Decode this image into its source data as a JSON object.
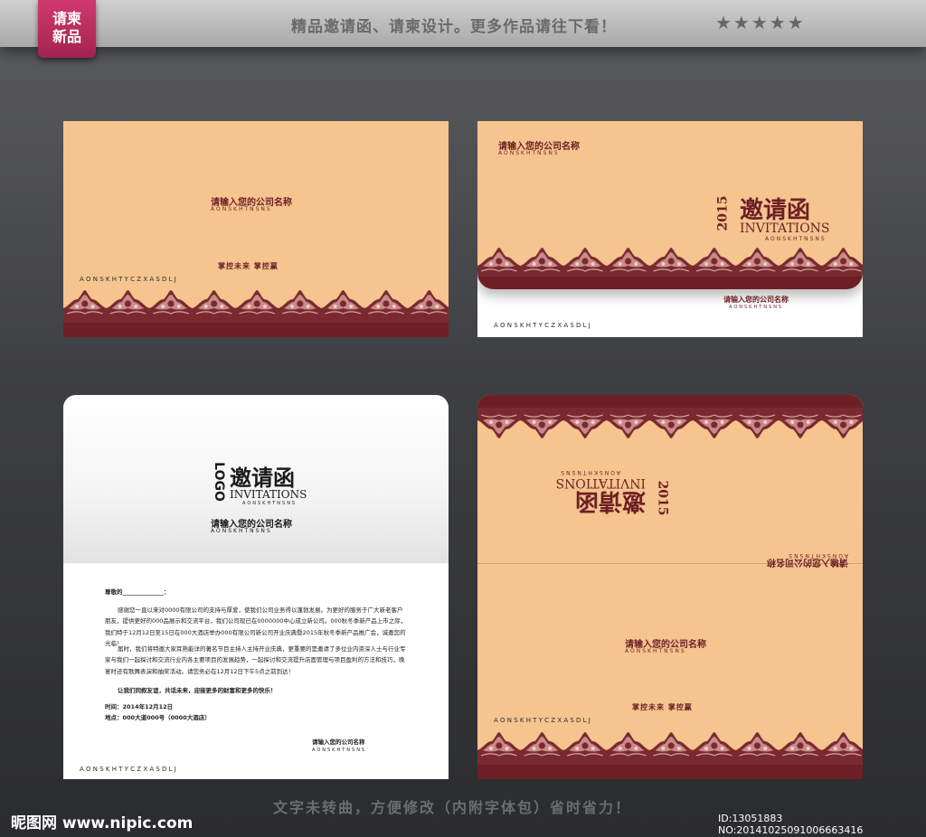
{
  "header": {
    "badge_line1": "请柬",
    "badge_line2": "新品",
    "title": "精品邀请函、请柬设计。更多作品请往下看！",
    "stars": "★★★★★"
  },
  "card": {
    "company_name": "请输入您的公司名称",
    "company_sub": "AONSKHTNSNS",
    "slogan": "掌控未来  掌控赢",
    "letters": "A  O  N  S  K  H  T  Y  C  Z  X  A  S  D  L  J",
    "invite_cn": "邀请函",
    "invite_en": "INVITATIONS",
    "invite_sub": "AONSKHTNSNS",
    "year": "2015",
    "logo": "LOGO"
  },
  "letter": {
    "greeting": "尊敬的______________：",
    "body": "感谢您一直以来对0000有限公司的支持与厚爱，使我们公司业务得以蓬勃发展。为更好的服务于广大新老客户朋友，提供更好的000品展示和交流平台，我们公司现已在0000000中心成立新公司。000秋冬季新产品上市之际，我们特于12月12日至15日在000大酒店举办000有限公司新公司开业庆典暨2015年秋冬季新产品推广会，诚邀您的光临！",
    "body2": "届时，我们将特邀大家耳熟能详的著名节目主持人主持开业庆典，更重要的是邀请了多位业内资深人士与行业专家与我们一起探讨和交流行业内各主要项目的发展趋势，一起探讨和交流提升店面管理与项目盈利的方法和技巧，晚宴时还有歌舞表演和抽奖活动。请您务必在12月12日下午5点之前到达！",
    "closing": "让我们同叙友谊，共话未来，迎接更多的财富和更多的快乐！",
    "time": "时间：2014年12月12日",
    "place": "地点：000大道000号（0000大酒店）",
    "signature": "请输入您的公司名称",
    "signature_sub": "AONSKHTNSNS"
  },
  "footer": {
    "note": "文字未转曲，方便修改（内附字体包）省时省力！",
    "site_logo": "昵图网 www.nipic.com",
    "id": "ID:13051883 NO:20141025091006663416"
  },
  "colors": {
    "tan": "#f5c48f",
    "maroon": "#6e1f25",
    "accent": "#a3234f"
  }
}
